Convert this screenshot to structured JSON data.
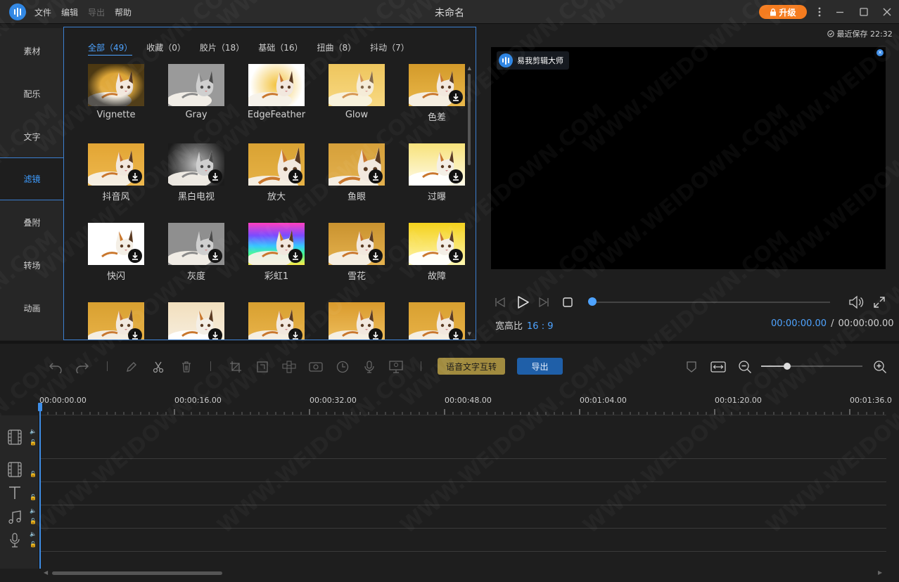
{
  "window": {
    "title": "未命名",
    "menu": [
      "文件",
      "编辑",
      "导出",
      "帮助"
    ],
    "upgrade_label": "升级"
  },
  "sidebar": {
    "items": [
      {
        "label": "素材"
      },
      {
        "label": "配乐"
      },
      {
        "label": "文字"
      },
      {
        "label": "滤镜"
      },
      {
        "label": "叠附"
      },
      {
        "label": "转场"
      },
      {
        "label": "动画"
      }
    ],
    "active": "滤镜"
  },
  "library": {
    "categories": [
      "全部（49）",
      "收藏（0）",
      "胶片（18）",
      "基础（16）",
      "扭曲（8）",
      "抖动（7）"
    ],
    "active_category": "全部（49）",
    "filters": [
      {
        "name": "Vignette",
        "download": false
      },
      {
        "name": "Gray",
        "download": false
      },
      {
        "name": "EdgeFeather",
        "download": false
      },
      {
        "name": "Glow",
        "download": false
      },
      {
        "name": "色差",
        "download": true
      },
      {
        "name": "抖音风",
        "download": true
      },
      {
        "name": "黑白电视",
        "download": true
      },
      {
        "name": "放大",
        "download": true
      },
      {
        "name": "鱼眼",
        "download": true
      },
      {
        "name": "过曝",
        "download": true
      },
      {
        "name": "快闪",
        "download": true
      },
      {
        "name": "灰度",
        "download": true
      },
      {
        "name": "彩虹1",
        "download": true
      },
      {
        "name": "雪花",
        "download": true
      },
      {
        "name": "故障",
        "download": true
      },
      {
        "name": "",
        "download": true
      },
      {
        "name": "",
        "download": true
      },
      {
        "name": "",
        "download": true
      },
      {
        "name": "",
        "download": true
      },
      {
        "name": "",
        "download": true
      }
    ]
  },
  "preview": {
    "last_saved": "最近保存 22:32",
    "brand_badge": "易我剪辑大师",
    "aspect_label": "宽高比",
    "aspect_value": "16 : 9",
    "current_time": "00:00:00.00",
    "total_time": "00:00:00.00",
    "separator": "/"
  },
  "toolbar": {
    "speech_label": "语音文字互转",
    "export_label": "导出",
    "zoom_level": 0.26
  },
  "timeline": {
    "ruler_labels": [
      "00:00:00.00",
      "00:00:16.00",
      "00:00:32.00",
      "00:00:48.00",
      "00:01:04.00",
      "00:01:20.00",
      "00:01:36.0"
    ]
  },
  "colors": {
    "accent": "#3e9cff",
    "upgrade": "#f57c1f",
    "speech_button": "#a18b3f",
    "export_button": "#1f5fa8"
  }
}
